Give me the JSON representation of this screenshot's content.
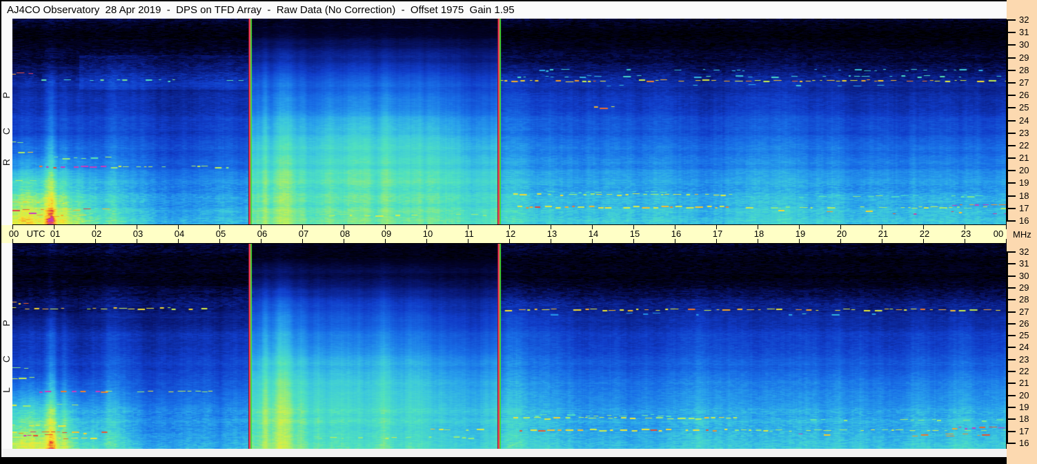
{
  "title": "AJ4CO Observatory  28 Apr 2019  -  DPS on TFD Array  -  Raw Data (No Correction)  -  Offset 1975  Gain 1.95",
  "panel_labels": {
    "top": "RCP",
    "bottom": "LCP"
  },
  "time_axis": {
    "utc_label": "UTC",
    "unit_label": "MHz",
    "hours": [
      "00",
      "01",
      "02",
      "03",
      "04",
      "05",
      "06",
      "07",
      "08",
      "09",
      "10",
      "11",
      "12",
      "13",
      "14",
      "15",
      "16",
      "17",
      "18",
      "19",
      "20",
      "21",
      "22",
      "23",
      "00"
    ]
  },
  "freq_axis": {
    "unit": "MHz",
    "ticks": [
      32,
      31,
      30,
      29,
      28,
      27,
      26,
      25,
      24,
      23,
      22,
      21,
      20,
      19,
      18,
      17,
      16
    ]
  },
  "colors": {
    "background": "#000000",
    "title_bg": "#fbfbfb",
    "time_axis_bg": "#ffffc6",
    "freq_scale_bg": "#fcd9b0",
    "marker_red": "#ff4060",
    "marker_dark": "#7a0e20",
    "marker_green": "#46dc32"
  },
  "chart_data": {
    "type": "heatmap",
    "title": "Dual-polarization dynamic spectrum, DPS on TFD Array, raw data",
    "xlabel": "UTC",
    "ylabel": "MHz",
    "x_range_hours": [
      0,
      24
    ],
    "x_tick_interval_hours": 1,
    "y_range_mhz": [
      16,
      32
    ],
    "y_tick_interval_mhz": 1,
    "panels": [
      {
        "name": "RCP",
        "seed": 12345
      },
      {
        "name": "LCP",
        "seed": 67890
      }
    ],
    "observation_break_markers_utc": [
      5.72,
      11.73
    ],
    "colormap": [
      [
        0.0,
        0,
        0,
        0
      ],
      [
        0.08,
        2,
        2,
        40
      ],
      [
        0.18,
        8,
        24,
        120
      ],
      [
        0.3,
        16,
        60,
        200
      ],
      [
        0.42,
        24,
        110,
        230
      ],
      [
        0.52,
        40,
        160,
        235
      ],
      [
        0.6,
        60,
        200,
        220
      ],
      [
        0.68,
        80,
        225,
        190
      ],
      [
        0.75,
        140,
        235,
        130
      ],
      [
        0.82,
        200,
        240,
        80
      ],
      [
        0.88,
        245,
        230,
        50
      ],
      [
        0.93,
        245,
        160,
        40
      ],
      [
        0.97,
        230,
        60,
        50
      ],
      [
        1.0,
        200,
        60,
        190
      ]
    ],
    "segments_rcp": [
      {
        "t0": 0,
        "t1": 5.72,
        "noise": 0.05,
        "stops": [
          [
            32,
            0.1
          ],
          [
            31.6,
            0.05
          ],
          [
            30.5,
            0.04
          ],
          [
            29,
            0.09
          ],
          [
            28,
            0.15
          ],
          [
            27,
            0.21
          ],
          [
            25,
            0.26
          ],
          [
            23,
            0.3
          ],
          [
            21,
            0.36
          ],
          [
            19,
            0.46
          ],
          [
            17,
            0.52
          ],
          [
            16,
            0.55
          ]
        ],
        "glow": {
          "amp": 0.3,
          "t": 0.4,
          "tsig": 1.7,
          "fmax": 23,
          "frange": 7
        },
        "box": {
          "tmin": 1.6,
          "fmin": 26.5,
          "fmax": 29.2,
          "amp": 0.05
        }
      },
      {
        "t0": 5.72,
        "t1": 11.73,
        "noise": 0.03,
        "stops": [
          [
            32,
            0.06
          ],
          [
            31.6,
            0.05
          ],
          [
            30,
            0.12
          ],
          [
            28.5,
            0.22
          ],
          [
            27,
            0.3
          ],
          [
            25,
            0.38
          ],
          [
            23,
            0.48
          ],
          [
            21,
            0.56
          ],
          [
            19,
            0.62
          ],
          [
            17,
            0.66
          ],
          [
            16,
            0.68
          ]
        ],
        "bulge": {
          "amp": 0.09,
          "t": 8.8,
          "tsig": 1.9,
          "f": 23.5,
          "fsig": 3.5
        }
      },
      {
        "t0": 11.73,
        "t1": 24,
        "noise": 0.05,
        "stops": [
          [
            32,
            0.08
          ],
          [
            31.5,
            0.04
          ],
          [
            30.5,
            0.03
          ],
          [
            29.5,
            0.07
          ],
          [
            28,
            0.17
          ],
          [
            27,
            0.23
          ],
          [
            25,
            0.3
          ],
          [
            23,
            0.36
          ],
          [
            21,
            0.44
          ],
          [
            19,
            0.5
          ],
          [
            17,
            0.56
          ],
          [
            16,
            0.58
          ]
        ],
        "rise": {
          "amp": 0.05,
          "fmax": 26,
          "frange": 10
        }
      }
    ],
    "segments_lcp": [
      {
        "t0": 0,
        "t1": 5.72,
        "noise": 0.05,
        "stops": [
          [
            32,
            0.1
          ],
          [
            31.6,
            0.05
          ],
          [
            30.5,
            0.04
          ],
          [
            29,
            0.08
          ],
          [
            28,
            0.12
          ],
          [
            27,
            0.15
          ],
          [
            26,
            0.21
          ],
          [
            25,
            0.26
          ],
          [
            23,
            0.3
          ],
          [
            21,
            0.36
          ],
          [
            19,
            0.46
          ],
          [
            17,
            0.52
          ],
          [
            16,
            0.55
          ]
        ],
        "glow": {
          "amp": 0.28,
          "t": 0.4,
          "tsig": 1.7,
          "fmax": 22,
          "frange": 6
        },
        "box": {
          "tmin": 1.6,
          "fmin": 26.5,
          "fmax": 29.2,
          "amp": 0.03
        }
      },
      {
        "t0": 5.72,
        "t1": 11.73,
        "noise": 0.03,
        "stops": [
          [
            32,
            0.06
          ],
          [
            31.6,
            0.05
          ],
          [
            30,
            0.12
          ],
          [
            28.5,
            0.22
          ],
          [
            27,
            0.3
          ],
          [
            25,
            0.38
          ],
          [
            23,
            0.48
          ],
          [
            21,
            0.56
          ],
          [
            19,
            0.62
          ],
          [
            17,
            0.66
          ],
          [
            16,
            0.68
          ]
        ],
        "bulge": {
          "amp": 0.06,
          "t": 8.8,
          "tsig": 1.9,
          "f": 23.5,
          "fsig": 3.5
        }
      },
      {
        "t0": 11.73,
        "t1": 24,
        "noise": 0.05,
        "stops": [
          [
            32,
            0.08
          ],
          [
            31.5,
            0.04
          ],
          [
            30.5,
            0.03
          ],
          [
            29.5,
            0.07
          ],
          [
            28,
            0.17
          ],
          [
            27,
            0.23
          ],
          [
            25,
            0.3
          ],
          [
            23,
            0.36
          ],
          [
            21,
            0.44
          ],
          [
            19,
            0.5
          ],
          [
            17,
            0.56
          ],
          [
            16,
            0.58
          ]
        ],
        "rise": {
          "amp": 0.05,
          "fmax": 26,
          "frange": 10
        }
      }
    ],
    "bright_columns": [
      {
        "t": 0.93,
        "sig": 0.14,
        "amp": 0.16
      },
      {
        "t": 1.25,
        "sig": 0.1,
        "amp": 0.08
      },
      {
        "t": 2.5,
        "sig": 0.35,
        "amp": 0.05
      },
      {
        "t": 6.55,
        "sig": 0.28,
        "amp": 0.12
      },
      {
        "t": 6.1,
        "sig": 0.08,
        "amp": 0.07
      },
      {
        "t": 7.0,
        "sig": 0.1,
        "amp": 0.05
      },
      {
        "t": 9.0,
        "sig": 0.15,
        "amp": 0.04
      },
      {
        "t": 11.1,
        "sig": 0.5,
        "amp": -0.04
      },
      {
        "t": 12.1,
        "sig": 0.3,
        "amp": 0.08
      },
      {
        "t": 2.4,
        "sig": 0.2,
        "amp": 0.07,
        "panel": "L"
      }
    ],
    "rfi_features": [
      {
        "panel": "R",
        "f": 27.25,
        "t0": 0.05,
        "t1": 5.6,
        "v": 0.7,
        "d": 0.4
      },
      {
        "panel": "L",
        "f": 27.3,
        "t0": 0.0,
        "t1": 4.7,
        "v": 0.86,
        "d": 0.75
      },
      {
        "panel": "B",
        "f": 27.2,
        "t0": 11.8,
        "t1": 24,
        "v": 0.88,
        "d": 0.65
      },
      {
        "panel": "R",
        "f": 27.55,
        "t0": 12.2,
        "t1": 24,
        "v": 0.62,
        "d": 0.3
      },
      {
        "panel": "R",
        "f": 28.05,
        "t0": 12.5,
        "t1": 23.8,
        "v": 0.58,
        "d": 0.22
      },
      {
        "panel": "B",
        "f": 26.85,
        "t0": 13,
        "t1": 21,
        "v": 0.55,
        "d": 0.15
      },
      {
        "panel": "B",
        "f": 18.15,
        "t0": 12.1,
        "t1": 17.6,
        "v": 0.84,
        "d": 0.75
      },
      {
        "panel": "B",
        "f": 17.15,
        "t0": 12.2,
        "t1": 17.3,
        "v": 0.9,
        "d": 0.85,
        "th": 2
      },
      {
        "panel": "B",
        "f": 17.1,
        "t0": 17.4,
        "t1": 24,
        "v": 0.8,
        "d": 0.45
      },
      {
        "panel": "B",
        "f": 17.35,
        "t0": 22.7,
        "t1": 24,
        "v": 0.99,
        "d": 0.9
      },
      {
        "panel": "B",
        "f": 16.8,
        "t0": 18.5,
        "t1": 24,
        "v": 0.95,
        "d": 0.12
      },
      {
        "panel": "B",
        "f": 16.6,
        "t0": 21,
        "t1": 24,
        "v": 1.0,
        "d": 0.2
      },
      {
        "panel": "B",
        "f": 20.35,
        "t0": 0.65,
        "t1": 2.25,
        "v": 1.0,
        "d": 0.85,
        "th": 2
      },
      {
        "panel": "B",
        "f": 20.35,
        "t0": 2.25,
        "t1": 5.35,
        "v": 0.8,
        "d": 0.55
      },
      {
        "panel": "B",
        "f": 16.95,
        "t0": 0,
        "t1": 2.3,
        "v": 0.92,
        "d": 0.8
      },
      {
        "panel": "B",
        "f": 16.45,
        "t0": 0,
        "t1": 1.9,
        "v": 0.88,
        "d": 0.7
      },
      {
        "panel": "B",
        "f": 17.5,
        "t0": 0,
        "t1": 1.3,
        "v": 0.84,
        "d": 0.6
      },
      {
        "panel": "B",
        "f": 16.7,
        "t0": 0,
        "t1": 0.95,
        "v": 1.0,
        "d": 0.45
      },
      {
        "panel": "B",
        "f": 19.2,
        "t0": 0,
        "t1": 1.5,
        "v": 0.8,
        "d": 0.5
      },
      {
        "panel": "R",
        "f": 21.05,
        "t0": 1.0,
        "t1": 2.4,
        "v": 0.75,
        "d": 0.5
      },
      {
        "panel": "B",
        "f": 16.5,
        "t0": 6.8,
        "t1": 11.5,
        "v": 0.78,
        "d": 0.3
      },
      {
        "panel": "B",
        "f": 27.8,
        "t0": 0,
        "t1": 0.4,
        "v": 0.93,
        "d": 0.9
      },
      {
        "panel": "B",
        "f": 21.5,
        "t0": 0,
        "t1": 0.45,
        "v": 0.85,
        "d": 0.8
      },
      {
        "panel": "B",
        "f": 22.3,
        "t0": 0,
        "t1": 0.3,
        "v": 0.8,
        "d": 0.7
      },
      {
        "panel": "R",
        "f": 25.05,
        "t0": 14.05,
        "t1": 14.55,
        "v": 0.92,
        "d": 0.9
      },
      {
        "panel": "B",
        "f": 18.0,
        "t0": 19,
        "t1": 24,
        "v": 0.72,
        "d": 0.35
      },
      {
        "panel": "B",
        "f": 18.35,
        "t0": 12.3,
        "t1": 16,
        "v": 0.7,
        "d": 0.3
      },
      {
        "panel": "L",
        "f": 17.2,
        "t0": 10.1,
        "t1": 11.35,
        "v": 0.84,
        "d": 0.8
      }
    ]
  }
}
